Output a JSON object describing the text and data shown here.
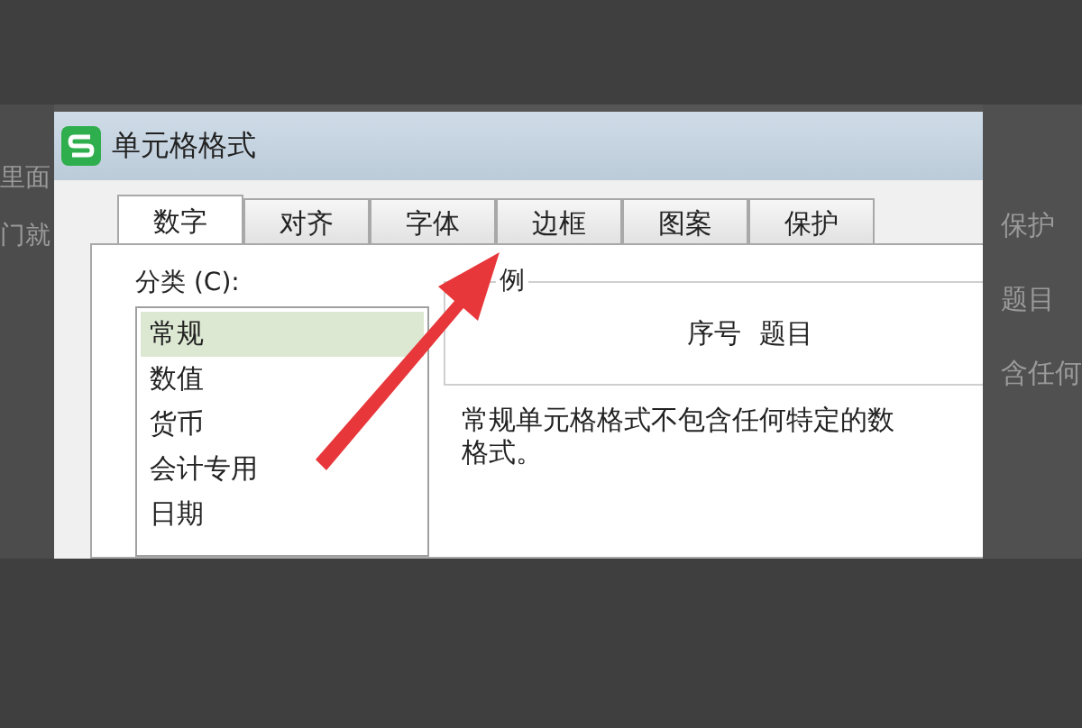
{
  "background": {
    "left_texts": [
      "里面",
      "门就"
    ],
    "right_texts": [
      "保护",
      "题目",
      "含任何"
    ]
  },
  "window": {
    "title": "单元格格式"
  },
  "tabs": [
    {
      "label": "数字",
      "selected": true
    },
    {
      "label": "对齐",
      "selected": false
    },
    {
      "label": "字体",
      "selected": false
    },
    {
      "label": "边框",
      "selected": false
    },
    {
      "label": "图案",
      "selected": false
    },
    {
      "label": "保护",
      "selected": false
    }
  ],
  "category": {
    "label": "分类 (C):",
    "items": [
      {
        "label": "常规",
        "selected": true
      },
      {
        "label": "数值",
        "selected": false
      },
      {
        "label": "货币",
        "selected": false
      },
      {
        "label": "会计专用",
        "selected": false
      },
      {
        "label": "日期",
        "selected": false
      }
    ]
  },
  "sample": {
    "legend": "例",
    "value": "序号  题目"
  },
  "description": [
    "常规单元格格式不包含任何特定的数",
    "格式。"
  ]
}
